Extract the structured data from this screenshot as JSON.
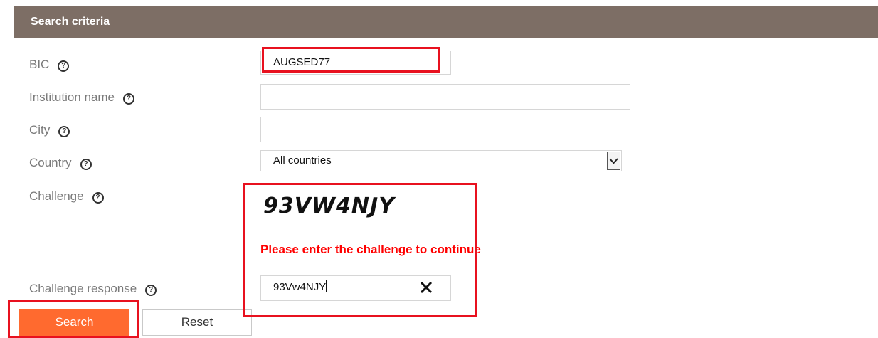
{
  "section": {
    "title": "Search criteria"
  },
  "fields": {
    "bic": {
      "label": "BIC",
      "value": "AUGSED77"
    },
    "institution_name": {
      "label": "Institution name",
      "value": ""
    },
    "city": {
      "label": "City",
      "value": ""
    },
    "country": {
      "label": "Country",
      "selected": "All countries"
    },
    "challenge": {
      "label": "Challenge",
      "captcha_text": "93VW4NJY"
    },
    "challenge_response": {
      "label": "Challenge response",
      "value": "93Vw4NJY"
    }
  },
  "help_icon_glyph": "?",
  "error_message": "Please enter the challenge to continue",
  "buttons": {
    "search": "Search",
    "reset": "Reset"
  },
  "colors": {
    "header_bg": "#7d6e65",
    "search_button": "#ff6a2f",
    "error_text": "#ff0000",
    "highlight": "#e8111f"
  },
  "icons": [
    "help-icon",
    "chevron-down-icon",
    "close-icon"
  ]
}
